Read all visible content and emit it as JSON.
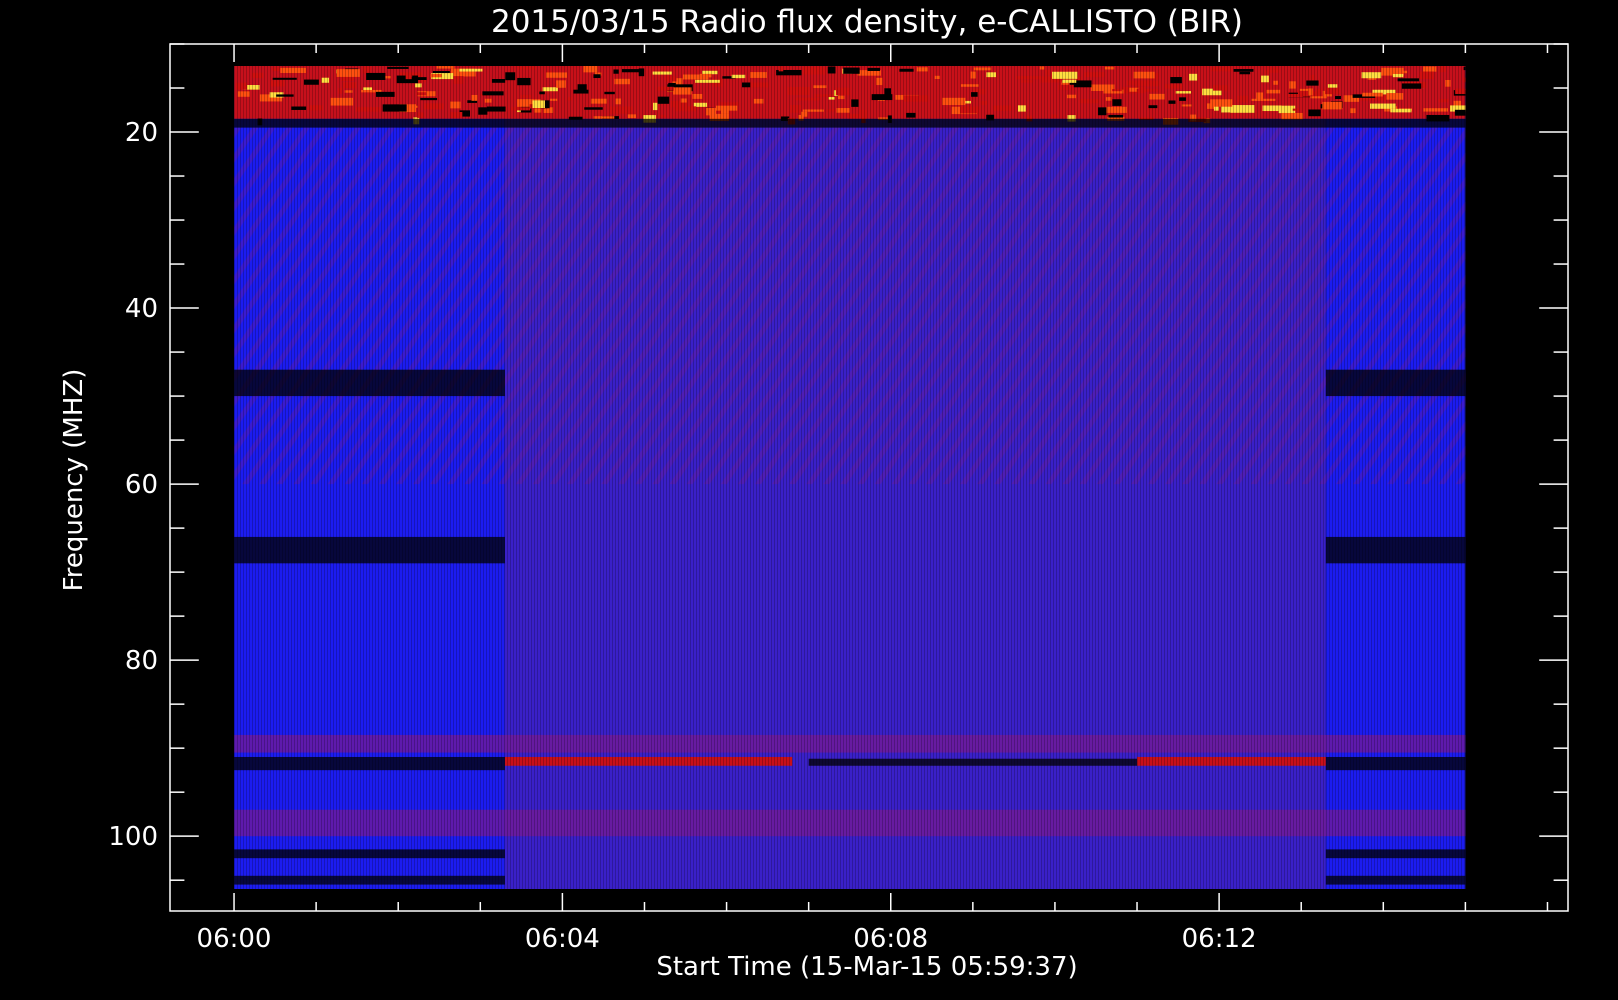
{
  "chart_data": {
    "type": "heatmap",
    "title": "2015/03/15  Radio flux density, e-CALLISTO (BIR)",
    "xlabel": "Start Time (15-Mar-15 05:59:37)",
    "ylabel": "Frequency (MHZ)",
    "x_axis": {
      "unit": "minutes after 06:00",
      "range": [
        -0.78,
        16.25
      ],
      "data_range": [
        0,
        15
      ],
      "major_ticks": [
        0,
        4,
        8,
        12
      ],
      "major_tick_labels": [
        "06:00",
        "06:04",
        "06:08",
        "06:12"
      ],
      "minor_tick_step": 1
    },
    "y_axis": {
      "unit": "MHz",
      "reversed": true,
      "range": [
        10,
        108.5
      ],
      "data_range": [
        12.5,
        106
      ],
      "major_ticks": [
        20,
        40,
        60,
        80,
        100
      ],
      "major_tick_labels": [
        "20",
        "40",
        "60",
        "80",
        "100"
      ],
      "minor_tick_step": 5
    },
    "grid": false,
    "colors": {
      "background": "#000000",
      "low": "#000000",
      "baseline": "#1c1cf0",
      "mid": "#3a20c8",
      "elevated": "#7a1a90",
      "high": "#d01010",
      "peak": "#ffdd40"
    },
    "time_segments": [
      {
        "name": "segment-a",
        "start": 0,
        "end": 3.3,
        "level": "baseline"
      },
      {
        "name": "segment-b",
        "start": 3.3,
        "end": 13.3,
        "level": "mid"
      },
      {
        "name": "segment-c",
        "start": 13.3,
        "end": 15,
        "level": "baseline"
      }
    ],
    "emission_bands": [
      {
        "freq_min": 12.5,
        "freq_max": 18.5,
        "t_start": 0,
        "t_end": 15,
        "intensity": "high",
        "note": "intense noisy emission near top"
      },
      {
        "freq_min": 91,
        "freq_max": 92,
        "t_start": 3.3,
        "t_end": 6.8,
        "intensity": "high"
      },
      {
        "freq_min": 91,
        "freq_max": 92,
        "t_start": 11,
        "t_end": 13.3,
        "intensity": "high"
      },
      {
        "freq_min": 88.5,
        "freq_max": 90.5,
        "t_start": 0,
        "t_end": 15,
        "intensity": "elevated"
      },
      {
        "freq_min": 97,
        "freq_max": 100,
        "t_start": 0,
        "t_end": 15,
        "intensity": "elevated"
      }
    ],
    "dark_bands": [
      {
        "freq_min": 18.5,
        "freq_max": 19.5,
        "t_start": 0,
        "t_end": 15
      },
      {
        "freq_min": 47,
        "freq_max": 50,
        "t_start": 0,
        "t_end": 3.3
      },
      {
        "freq_min": 47,
        "freq_max": 50,
        "t_start": 13.3,
        "t_end": 15
      },
      {
        "freq_min": 66,
        "freq_max": 69,
        "t_start": 0,
        "t_end": 3.3
      },
      {
        "freq_min": 66,
        "freq_max": 69,
        "t_start": 13.3,
        "t_end": 15
      },
      {
        "freq_min": 91,
        "freq_max": 92.5,
        "t_start": 0,
        "t_end": 3.3
      },
      {
        "freq_min": 91,
        "freq_max": 92.5,
        "t_start": 13.3,
        "t_end": 15
      },
      {
        "freq_min": 91.2,
        "freq_max": 92,
        "t_start": 7,
        "t_end": 11
      },
      {
        "freq_min": 101.5,
        "freq_max": 102.5,
        "t_start": 0,
        "t_end": 3.3
      },
      {
        "freq_min": 101.5,
        "freq_max": 102.5,
        "t_start": 13.3,
        "t_end": 15
      },
      {
        "freq_min": 104.5,
        "freq_max": 105.5,
        "t_start": 0,
        "t_end": 3.3
      },
      {
        "freq_min": 104.5,
        "freq_max": 105.5,
        "t_start": 13.3,
        "t_end": 15
      }
    ]
  }
}
